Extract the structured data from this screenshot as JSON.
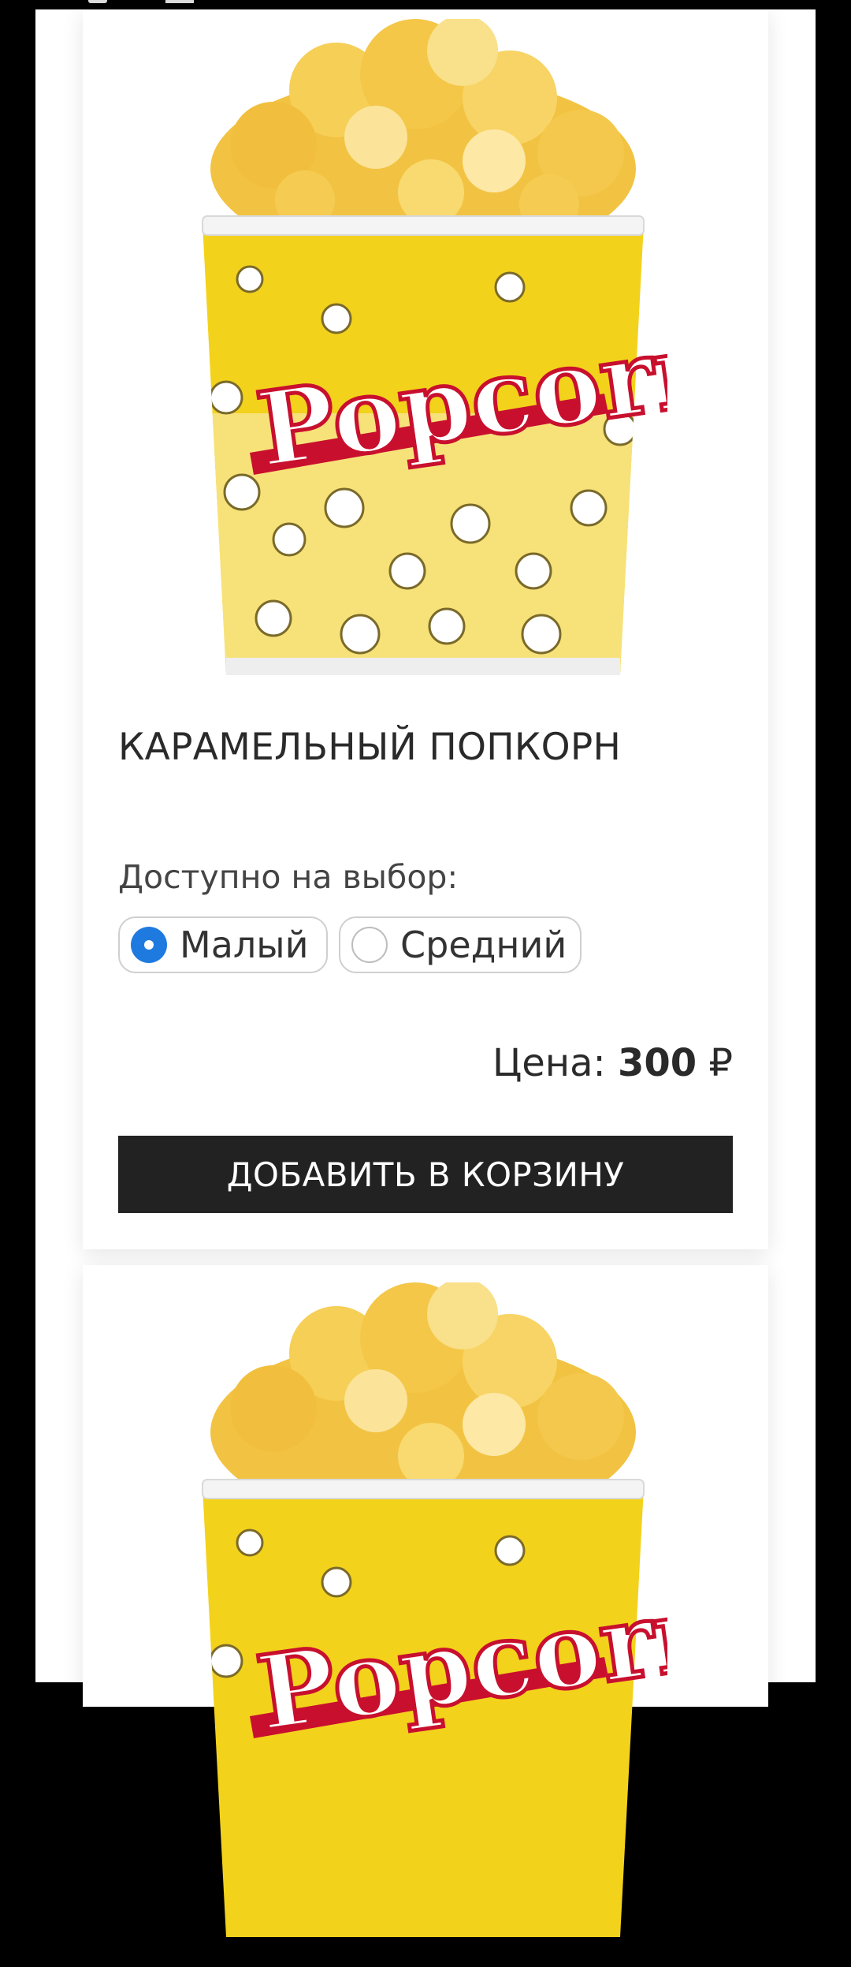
{
  "product": {
    "title": "КАРАМЕЛЬНЫЙ ПОПКОРН",
    "image_icon": "popcorn-bucket-image",
    "image_brand_text": "Popcorn",
    "variants_label": "Доступно на выбор:",
    "variants": [
      {
        "label": "Малый",
        "selected": true
      },
      {
        "label": "Средний",
        "selected": false
      }
    ],
    "price_label": "Цена:",
    "price_value": "300",
    "currency": "₽",
    "add_to_cart_label": "ДОБАВИТЬ В КОРЗИНУ"
  },
  "colors": {
    "accent": "#1f7ae0",
    "button": "#222222",
    "bucket_yellow": "#f3d21c",
    "logo_red": "#c8102e"
  }
}
